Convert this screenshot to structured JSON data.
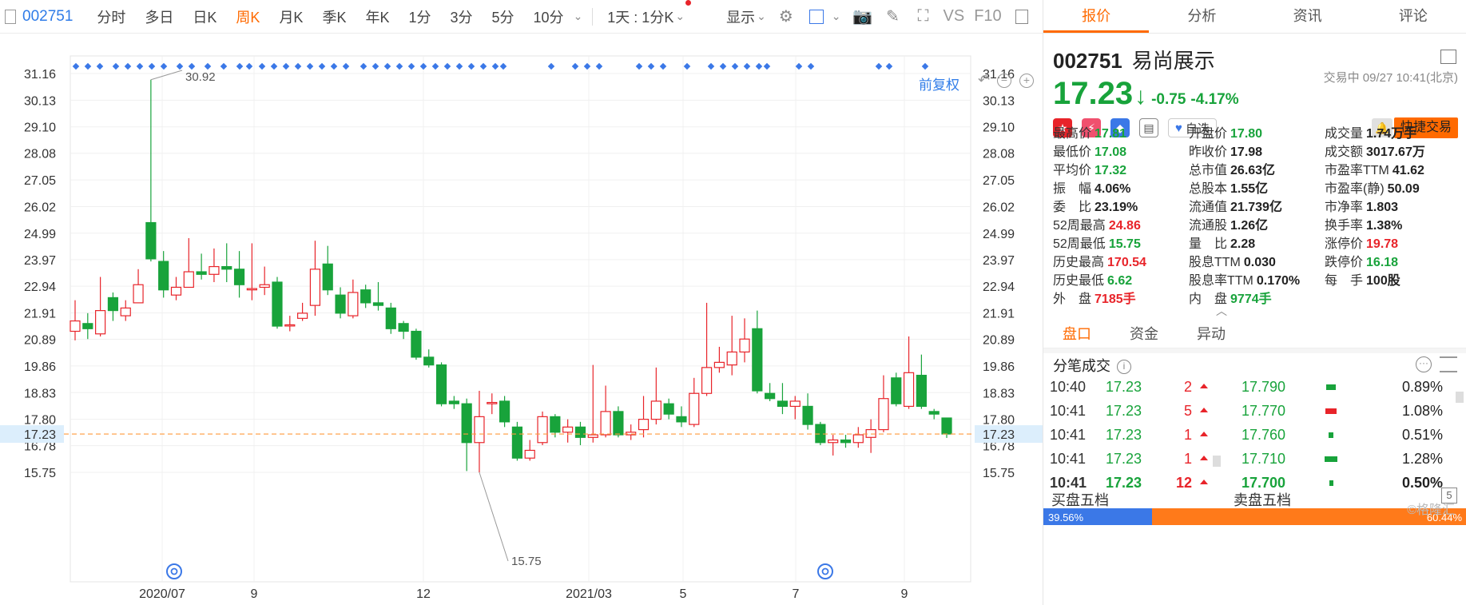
{
  "toolbar": {
    "code": "002751",
    "timeframes": [
      "分时",
      "多日",
      "日K",
      "周K",
      "月K",
      "季K",
      "年K",
      "1分",
      "3分",
      "5分",
      "10分"
    ],
    "active_timeframe": "周K",
    "period_select": "1天 : 1分K",
    "display_label": "显示",
    "vs_label": "VS",
    "f10_label": "F10",
    "adjust_label": "前复权"
  },
  "chart_data": {
    "type": "candlestick",
    "y_ticks": [
      "31.16",
      "30.13",
      "29.10",
      "28.08",
      "27.05",
      "26.02",
      "24.99",
      "23.97",
      "22.94",
      "21.91",
      "20.89",
      "19.86",
      "18.83",
      "17.80",
      "16.78",
      "15.75"
    ],
    "x_ticks": [
      "2020/07",
      "9",
      "12",
      "2021/03",
      "5",
      "7",
      "9"
    ],
    "current_price": "17.23",
    "annotations": {
      "high": "30.92",
      "low": "15.75"
    },
    "candles": [
      {
        "o": 21.2,
        "c": 21.6,
        "h": 22.4,
        "l": 20.85
      },
      {
        "o": 21.5,
        "c": 21.3,
        "h": 21.9,
        "l": 20.9
      },
      {
        "o": 21.1,
        "c": 22.0,
        "h": 23.3,
        "l": 21.0
      },
      {
        "o": 22.5,
        "c": 22.0,
        "h": 22.7,
        "l": 21.6
      },
      {
        "o": 21.8,
        "c": 22.1,
        "h": 22.4,
        "l": 21.6
      },
      {
        "o": 22.3,
        "c": 23.0,
        "h": 23.6,
        "l": 22.3
      },
      {
        "o": 25.4,
        "c": 24.0,
        "h": 30.92,
        "l": 23.9
      },
      {
        "o": 23.9,
        "c": 22.8,
        "h": 24.3,
        "l": 22.5
      },
      {
        "o": 22.6,
        "c": 22.9,
        "h": 23.3,
        "l": 22.4
      },
      {
        "o": 22.9,
        "c": 23.5,
        "h": 24.8,
        "l": 22.9
      },
      {
        "o": 23.5,
        "c": 23.4,
        "h": 24.2,
        "l": 23.2
      },
      {
        "o": 23.4,
        "c": 23.7,
        "h": 24.4,
        "l": 23.1
      },
      {
        "o": 23.7,
        "c": 23.6,
        "h": 24.6,
        "l": 23.1
      },
      {
        "o": 23.6,
        "c": 23.0,
        "h": 24.3,
        "l": 22.5
      },
      {
        "o": 22.8,
        "c": 22.85,
        "h": 24.6,
        "l": 22.4
      },
      {
        "o": 22.9,
        "c": 23.0,
        "h": 23.7,
        "l": 22.6
      },
      {
        "o": 23.1,
        "c": 21.4,
        "h": 23.3,
        "l": 21.3
      },
      {
        "o": 21.45,
        "c": 21.45,
        "h": 21.8,
        "l": 21.2
      },
      {
        "o": 21.7,
        "c": 21.9,
        "h": 22.3,
        "l": 21.6
      },
      {
        "o": 22.2,
        "c": 23.6,
        "h": 24.7,
        "l": 21.8
      },
      {
        "o": 23.8,
        "c": 22.8,
        "h": 24.5,
        "l": 22.6
      },
      {
        "o": 22.6,
        "c": 21.9,
        "h": 22.9,
        "l": 21.7
      },
      {
        "o": 21.8,
        "c": 22.7,
        "h": 23.2,
        "l": 21.7
      },
      {
        "o": 22.8,
        "c": 22.3,
        "h": 23.0,
        "l": 22.1
      },
      {
        "o": 22.3,
        "c": 22.2,
        "h": 23.1,
        "l": 22.0
      },
      {
        "o": 22.1,
        "c": 21.3,
        "h": 22.3,
        "l": 21.1
      },
      {
        "o": 21.5,
        "c": 21.2,
        "h": 21.6,
        "l": 20.9
      },
      {
        "o": 21.2,
        "c": 20.2,
        "h": 21.3,
        "l": 20.1
      },
      {
        "o": 20.2,
        "c": 19.9,
        "h": 20.5,
        "l": 19.8
      },
      {
        "o": 19.9,
        "c": 18.4,
        "h": 20.0,
        "l": 18.3
      },
      {
        "o": 18.5,
        "c": 18.4,
        "h": 18.7,
        "l": 18.2
      },
      {
        "o": 18.4,
        "c": 16.9,
        "h": 18.6,
        "l": 15.8
      },
      {
        "o": 16.9,
        "c": 17.9,
        "h": 18.9,
        "l": 15.75
      },
      {
        "o": 18.4,
        "c": 18.45,
        "h": 18.8,
        "l": 18.0
      },
      {
        "o": 18.5,
        "c": 17.7,
        "h": 18.7,
        "l": 17.5
      },
      {
        "o": 17.5,
        "c": 16.3,
        "h": 17.7,
        "l": 16.2
      },
      {
        "o": 16.3,
        "c": 16.6,
        "h": 17.0,
        "l": 16.2
      },
      {
        "o": 16.9,
        "c": 17.9,
        "h": 18.1,
        "l": 16.8
      },
      {
        "o": 17.9,
        "c": 17.3,
        "h": 18.0,
        "l": 17.1
      },
      {
        "o": 17.3,
        "c": 17.5,
        "h": 17.8,
        "l": 16.9
      },
      {
        "o": 17.5,
        "c": 17.1,
        "h": 17.7,
        "l": 16.8
      },
      {
        "o": 17.1,
        "c": 17.2,
        "h": 19.9,
        "l": 16.9
      },
      {
        "o": 17.2,
        "c": 18.1,
        "h": 19.1,
        "l": 17.1
      },
      {
        "o": 18.1,
        "c": 17.2,
        "h": 18.3,
        "l": 17.1
      },
      {
        "o": 17.2,
        "c": 17.3,
        "h": 17.6,
        "l": 17.0
      },
      {
        "o": 17.4,
        "c": 17.8,
        "h": 18.7,
        "l": 17.1
      },
      {
        "o": 17.8,
        "c": 18.5,
        "h": 19.8,
        "l": 17.6
      },
      {
        "o": 18.4,
        "c": 18.0,
        "h": 18.6,
        "l": 17.8
      },
      {
        "o": 17.9,
        "c": 17.7,
        "h": 18.3,
        "l": 17.5
      },
      {
        "o": 17.6,
        "c": 18.8,
        "h": 19.4,
        "l": 17.5
      },
      {
        "o": 18.8,
        "c": 19.8,
        "h": 22.3,
        "l": 18.7
      },
      {
        "o": 19.8,
        "c": 20.0,
        "h": 20.6,
        "l": 19.6
      },
      {
        "o": 19.9,
        "c": 20.4,
        "h": 21.8,
        "l": 19.5
      },
      {
        "o": 20.4,
        "c": 20.9,
        "h": 21.7,
        "l": 20.0
      },
      {
        "o": 21.3,
        "c": 18.9,
        "h": 22.0,
        "l": 18.8
      },
      {
        "o": 18.8,
        "c": 18.6,
        "h": 19.2,
        "l": 18.5
      },
      {
        "o": 18.5,
        "c": 18.3,
        "h": 19.2,
        "l": 18.0
      },
      {
        "o": 18.3,
        "c": 18.5,
        "h": 18.7,
        "l": 17.8
      },
      {
        "o": 18.3,
        "c": 17.6,
        "h": 18.8,
        "l": 17.4
      },
      {
        "o": 17.6,
        "c": 16.9,
        "h": 17.7,
        "l": 16.8
      },
      {
        "o": 16.9,
        "c": 17.0,
        "h": 17.2,
        "l": 16.4
      },
      {
        "o": 17.0,
        "c": 16.9,
        "h": 17.2,
        "l": 16.7
      },
      {
        "o": 16.9,
        "c": 17.2,
        "h": 17.5,
        "l": 16.7
      },
      {
        "o": 17.1,
        "c": 17.4,
        "h": 17.8,
        "l": 16.5
      },
      {
        "o": 17.4,
        "c": 18.6,
        "h": 19.5,
        "l": 17.3
      },
      {
        "o": 19.4,
        "c": 18.4,
        "h": 19.6,
        "l": 18.3
      },
      {
        "o": 18.3,
        "c": 19.6,
        "h": 21.0,
        "l": 18.2
      },
      {
        "o": 19.5,
        "c": 18.3,
        "h": 20.3,
        "l": 18.2
      },
      {
        "o": 18.1,
        "c": 18.0,
        "h": 18.2,
        "l": 17.8
      },
      {
        "o": 17.85,
        "c": 17.23,
        "h": 17.85,
        "l": 17.08
      }
    ]
  },
  "panel": {
    "tabs": [
      "报价",
      "分析",
      "资讯",
      "评论"
    ],
    "active_tab": "报价",
    "code": "002751",
    "name": "易尚展示",
    "price": "17.23",
    "change": "-0.75",
    "change_pct": "-4.17%",
    "status": "交易中 09/27 10:41(北京)",
    "fav_label": "自选",
    "trade_label": "快捷交易",
    "stats": [
      [
        {
          "l": "最高价",
          "v": "17.81",
          "c": "dn"
        },
        {
          "l": "开盘价",
          "v": "17.80",
          "c": "dn"
        },
        {
          "l": "成交量",
          "v": "1.74万手",
          "c": ""
        }
      ],
      [
        {
          "l": "最低价",
          "v": "17.08",
          "c": "dn"
        },
        {
          "l": "昨收价",
          "v": "17.98",
          "c": ""
        },
        {
          "l": "成交额",
          "v": "3017.67万",
          "c": ""
        }
      ],
      [
        {
          "l": "平均价",
          "v": "17.32",
          "c": "dn"
        },
        {
          "l": "总市值",
          "v": "26.63亿",
          "c": ""
        },
        {
          "l": "市盈率TTM",
          "v": "41.62",
          "c": ""
        }
      ],
      [
        {
          "l": "振　幅",
          "v": "4.06%",
          "c": ""
        },
        {
          "l": "总股本",
          "v": "1.55亿",
          "c": ""
        },
        {
          "l": "市盈率(静)",
          "v": "50.09",
          "c": ""
        }
      ],
      [
        {
          "l": "委　比",
          "v": "23.19%",
          "c": ""
        },
        {
          "l": "流通值",
          "v": "21.739亿",
          "c": ""
        },
        {
          "l": "市净率",
          "v": "1.803",
          "c": ""
        }
      ],
      [
        {
          "l": "52周最高",
          "v": "24.86",
          "c": "up"
        },
        {
          "l": "流通股",
          "v": "1.26亿",
          "c": ""
        },
        {
          "l": "换手率",
          "v": "1.38%",
          "c": ""
        }
      ],
      [
        {
          "l": "52周最低",
          "v": "15.75",
          "c": "dn"
        },
        {
          "l": "量　比",
          "v": "2.28",
          "c": ""
        },
        {
          "l": "涨停价",
          "v": "19.78",
          "c": "up"
        }
      ],
      [
        {
          "l": "历史最高",
          "v": "170.54",
          "c": "up"
        },
        {
          "l": "股息TTM",
          "v": "0.030",
          "c": ""
        },
        {
          "l": "跌停价",
          "v": "16.18",
          "c": "dn"
        }
      ],
      [
        {
          "l": "历史最低",
          "v": "6.62",
          "c": "dn"
        },
        {
          "l": "股息率TTM",
          "v": "0.170%",
          "c": ""
        },
        {
          "l": "每　手",
          "v": "100股",
          "c": ""
        }
      ],
      [
        {
          "l": "外　盘",
          "v": "7185手",
          "c": "up"
        },
        {
          "l": "内　盘",
          "v": "9774手",
          "c": "dn"
        },
        {
          "l": "",
          "v": "",
          "c": ""
        }
      ]
    ],
    "subtabs": [
      "盘口",
      "资金",
      "异动"
    ],
    "ticks_title": "分笔成交",
    "ticks": [
      {
        "t": "10:40",
        "p": "17.23",
        "v": "2",
        "bp": "17.790",
        "bc": "#18a33b",
        "bw": 12,
        "pct": "0.89%"
      },
      {
        "t": "10:41",
        "p": "17.23",
        "v": "5",
        "bp": "17.770",
        "bc": "#e8242a",
        "bw": 14,
        "pct": "1.08%"
      },
      {
        "t": "10:41",
        "p": "17.23",
        "v": "1",
        "bp": "17.760",
        "bc": "#18a33b",
        "bw": 6,
        "pct": "0.51%"
      },
      {
        "t": "10:41",
        "p": "17.23",
        "v": "1",
        "bp": "17.710",
        "bc": "#18a33b",
        "bw": 16,
        "pct": "1.28%"
      },
      {
        "t": "10:41",
        "p": "17.23",
        "v": "12",
        "bp": "17.700",
        "bc": "#18a33b",
        "bw": 5,
        "pct": "0.50%"
      }
    ],
    "bid_title": "买盘五档",
    "ask_title": "卖盘五档",
    "bid_pct_label": "39.56%",
    "ask_pct_label": "60.44%",
    "bid_pct": 0.2567,
    "watermark": "格隆汇"
  }
}
